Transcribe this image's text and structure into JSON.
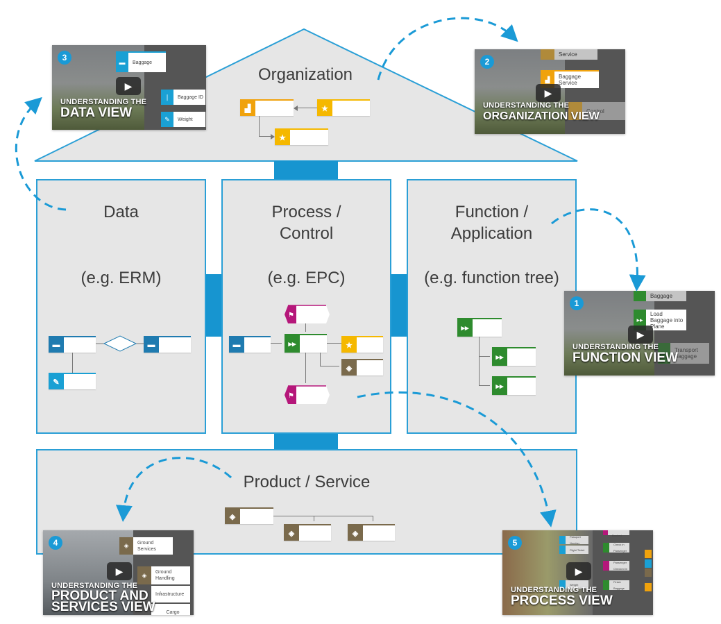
{
  "colors": {
    "frame": "#2a9fd6",
    "connector": "#1795d0",
    "panel": "#e6e6e6",
    "arrow": "#1a9ad6",
    "data": "#1f7bb0",
    "data_light": "#1aa0d4",
    "org": "#f0a20c",
    "role": "#f5b800",
    "function": "#2e8b2e",
    "event": "#b5177a",
    "product": "#7a6a4c"
  },
  "house": {
    "organization": "Organization",
    "data": {
      "title": "Data",
      "example": "(e.g. ERM)"
    },
    "process": {
      "title_line1": "Process /",
      "title_line2": "Control",
      "example": "(e.g. EPC)"
    },
    "function": {
      "title_line1": "Function /",
      "title_line2": "Application",
      "example": "(e.g. function tree)"
    },
    "product": "Product / Service"
  },
  "videos": [
    {
      "number": "1",
      "line1": "UNDERSTANDING THE",
      "line2": "FUNCTION VIEW",
      "boxes": [
        "Baggage",
        "Load Baggage into Plane",
        "Transport Baggage"
      ]
    },
    {
      "number": "2",
      "line1": "UNDERSTANDING THE",
      "line2": "ORGANIZATION VIEW",
      "boxes": [
        "Service",
        "Baggage Service",
        "Control"
      ]
    },
    {
      "number": "3",
      "line1": "UNDERSTANDING THE",
      "line2": "DATA VIEW",
      "boxes": [
        "Baggage",
        "Baggage ID",
        "Weight"
      ]
    },
    {
      "number": "4",
      "line1": "UNDERSTANDING THE",
      "line2": "PRODUCT AND",
      "line3": "SERVICES VIEW",
      "boxes": [
        "Ground Services",
        "Ground Handling",
        "Infrastructure",
        "Cargo"
      ]
    },
    {
      "number": "5",
      "line1": "UNDERSTANDING THE",
      "line2": "PROCESS VIEW",
      "boxes": [
        "Check-in Booked",
        "Passport Number",
        "Flight Ticket",
        "Check in Passenger",
        "Passenger Checked in",
        "Weight",
        "Finish Baggage"
      ]
    }
  ],
  "play_icon": "▶"
}
